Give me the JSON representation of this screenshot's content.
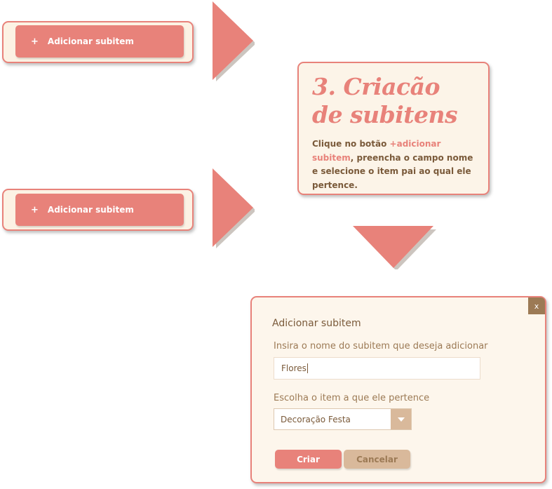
{
  "buttons": {
    "add_subitem_icon": "+",
    "add_subitem_label": "Adicionar subitem"
  },
  "info": {
    "title_line1": "3. Criacão",
    "title_line2": "de subitens",
    "desc_before": "Clique no botão ",
    "desc_highlight": "+adicionar subitem",
    "desc_after": ", preencha o campo nome e selecione o item pai ao qual ele pertence."
  },
  "dialog": {
    "close_label": "x",
    "title": "Adicionar subitem",
    "name_label": "Insira o nome do subitem que deseja adicionar",
    "name_value": "Flores",
    "parent_label": "Escolha o item a que ele pertence",
    "parent_value": "Decoração Festa",
    "create_label": "Criar",
    "cancel_label": "Cancelar"
  },
  "colors": {
    "accent": "#e8827a",
    "card_bg": "#fcf2e4",
    "text_brown": "#7a5a3a",
    "cancel_tan": "#d9b99b"
  }
}
